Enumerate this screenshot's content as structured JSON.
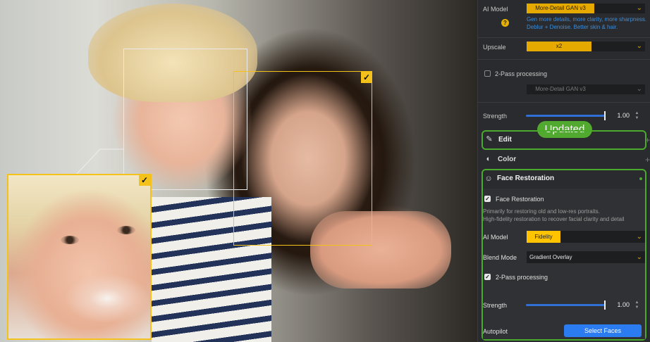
{
  "panel": {
    "ai_model_top": {
      "label": "AI Model",
      "value": "More-Detail GAN  v3",
      "description_line1": "Gen more details, more clarity, more sharpness.",
      "description_line2": "Deblur + Denoise. Better skin & hair."
    },
    "upscale": {
      "label": "Upscale",
      "value": "x2"
    },
    "two_pass_top": {
      "label": "2-Pass processing",
      "checked": false,
      "model": "More-Detail GAN  v3"
    },
    "strength_top": {
      "label": "Strength",
      "value": "1.00"
    },
    "badge": "Updated",
    "sections": {
      "edit": "Edit",
      "color": "Color",
      "face_restoration": "Face Restoration"
    },
    "face_restoration": {
      "checkbox_label": "Face Restoration",
      "description_line1": "Primarily for restoring old and low-res portraits.",
      "description_line2": "High-fidelity restoration to recover facial clarity and detail",
      "ai_model_label": "AI Model",
      "ai_model_value": "Fidelity",
      "blend_mode_label": "Blend Mode",
      "blend_mode_value": "Gradient Overlay",
      "two_pass_label": "2-Pass processing",
      "strength_label": "Strength",
      "strength_value": "1.00",
      "autopilot_label": "Autopilot",
      "select_faces_label": "Select Faces"
    }
  },
  "colors": {
    "accent_yellow": "#e6a900",
    "update_green": "#4aaa2b",
    "slider_blue": "#2f6fd6",
    "button_blue": "#2b7cf0"
  }
}
